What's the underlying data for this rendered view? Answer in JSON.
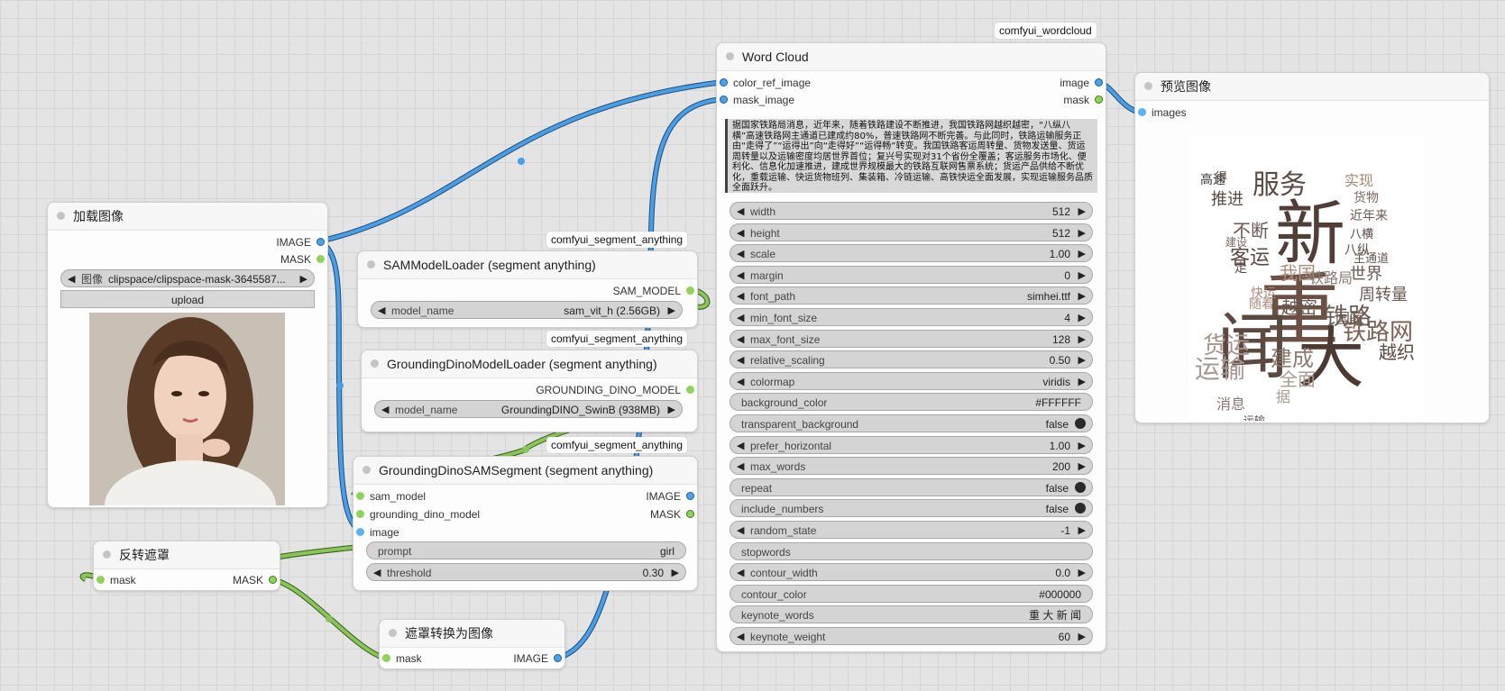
{
  "colors": {
    "image_link": "#4a9ee6",
    "mask_link": "#8cc45a",
    "canvas": "#e4e4e4"
  },
  "load_image": {
    "title": "加载图像",
    "outputs": [
      "IMAGE",
      "MASK"
    ],
    "image_label": "图像",
    "image_value": "clipspace/clipspace-mask-3645587...",
    "upload_label": "upload"
  },
  "sam_loader": {
    "badge": "comfyui_segment_anything",
    "title": "SAMModelLoader (segment anything)",
    "output": "SAM_MODEL",
    "widget_label": "model_name",
    "widget_value": "sam_vit_h (2.56GB)"
  },
  "dino_loader": {
    "badge": "comfyui_segment_anything",
    "title": "GroundingDinoModelLoader (segment anything)",
    "output": "GROUNDING_DINO_MODEL",
    "widget_label": "model_name",
    "widget_value": "GroundingDINO_SwinB (938MB)"
  },
  "dino_sam": {
    "badge": "comfyui_segment_anything",
    "title": "GroundingDinoSAMSegment (segment anything)",
    "inputs": [
      "sam_model",
      "grounding_dino_model",
      "image"
    ],
    "outputs": [
      "IMAGE",
      "MASK"
    ],
    "prompt_label": "prompt",
    "prompt_value": "girl",
    "threshold_label": "threshold",
    "threshold_value": "0.30"
  },
  "invert_mask": {
    "title": "反转遮罩",
    "input": "mask",
    "output": "MASK"
  },
  "mask_to_image": {
    "title": "遮罩转换为图像",
    "input": "mask",
    "output": "IMAGE"
  },
  "word_cloud": {
    "badge": "comfyui_wordcloud",
    "title": "Word Cloud",
    "inputs": [
      "color_ref_image",
      "mask_image"
    ],
    "outputs": [
      "image",
      "mask"
    ],
    "text": "据国家铁路局消息，近年来，随着铁路建设不断推进，我国铁路网越织越密，“八纵八横”高速铁路网主通道已建成约80%，普速铁路网不断完善。与此同时，铁路运输服务正由“走得了”“运得出”向“走得好”“运得畅”转变。我国铁路客运周转量、货物发送量、货运周转量以及运输密度均居世界首位；复兴号实现对31个省份全覆盖；客运服务市场化、便利化、信息化加速推进，建成世界规模最大的铁路互联网售票系统；货运产品供给不断优化，重载运输、快运货物班列、集装箱、冷链运输、高铁快运全面发展，实现运输服务品质全面跃升。",
    "widgets": [
      {
        "label": "width",
        "value": "512",
        "type": "number"
      },
      {
        "label": "height",
        "value": "512",
        "type": "number"
      },
      {
        "label": "scale",
        "value": "1.00",
        "type": "number"
      },
      {
        "label": "margin",
        "value": "0",
        "type": "number"
      },
      {
        "label": "font_path",
        "value": "simhei.ttf",
        "type": "number"
      },
      {
        "label": "min_font_size",
        "value": "4",
        "type": "number"
      },
      {
        "label": "max_font_size",
        "value": "128",
        "type": "number"
      },
      {
        "label": "relative_scaling",
        "value": "0.50",
        "type": "number"
      },
      {
        "label": "colormap",
        "value": "viridis",
        "type": "number"
      },
      {
        "label": "background_color",
        "value": "#FFFFFF",
        "type": "text"
      },
      {
        "label": "transparent_background",
        "value": "false",
        "type": "toggle"
      },
      {
        "label": "prefer_horizontal",
        "value": "1.00",
        "type": "number"
      },
      {
        "label": "max_words",
        "value": "200",
        "type": "number"
      },
      {
        "label": "repeat",
        "value": "false",
        "type": "toggle"
      },
      {
        "label": "include_numbers",
        "value": "false",
        "type": "toggle"
      },
      {
        "label": "random_state",
        "value": "-1",
        "type": "number"
      },
      {
        "label": "stopwords",
        "value": "",
        "type": "text"
      },
      {
        "label": "contour_width",
        "value": "0.0",
        "type": "number"
      },
      {
        "label": "contour_color",
        "value": "#000000",
        "type": "text"
      },
      {
        "label": "keynote_words",
        "value": "重 大 新 闻",
        "type": "text"
      },
      {
        "label": "keynote_weight",
        "value": "60",
        "type": "number"
      }
    ]
  },
  "preview": {
    "title": "预览图像",
    "input": "images",
    "words": [
      "新",
      "重",
      "闻",
      "大",
      "服务",
      "铁路网",
      "运输",
      "铁路",
      "建成",
      "货运",
      "客运",
      "不断",
      "推进",
      "我国",
      "世界",
      "周转量",
      "实现",
      "货物",
      "近年来",
      "高速",
      "八纵",
      "八横",
      "主通道",
      "铁路局",
      "国家",
      "全面",
      "快运",
      "随着",
      "越密",
      "越织",
      "走",
      "得",
      "建设",
      "据",
      "消息",
      "运输",
      "普速"
    ]
  }
}
